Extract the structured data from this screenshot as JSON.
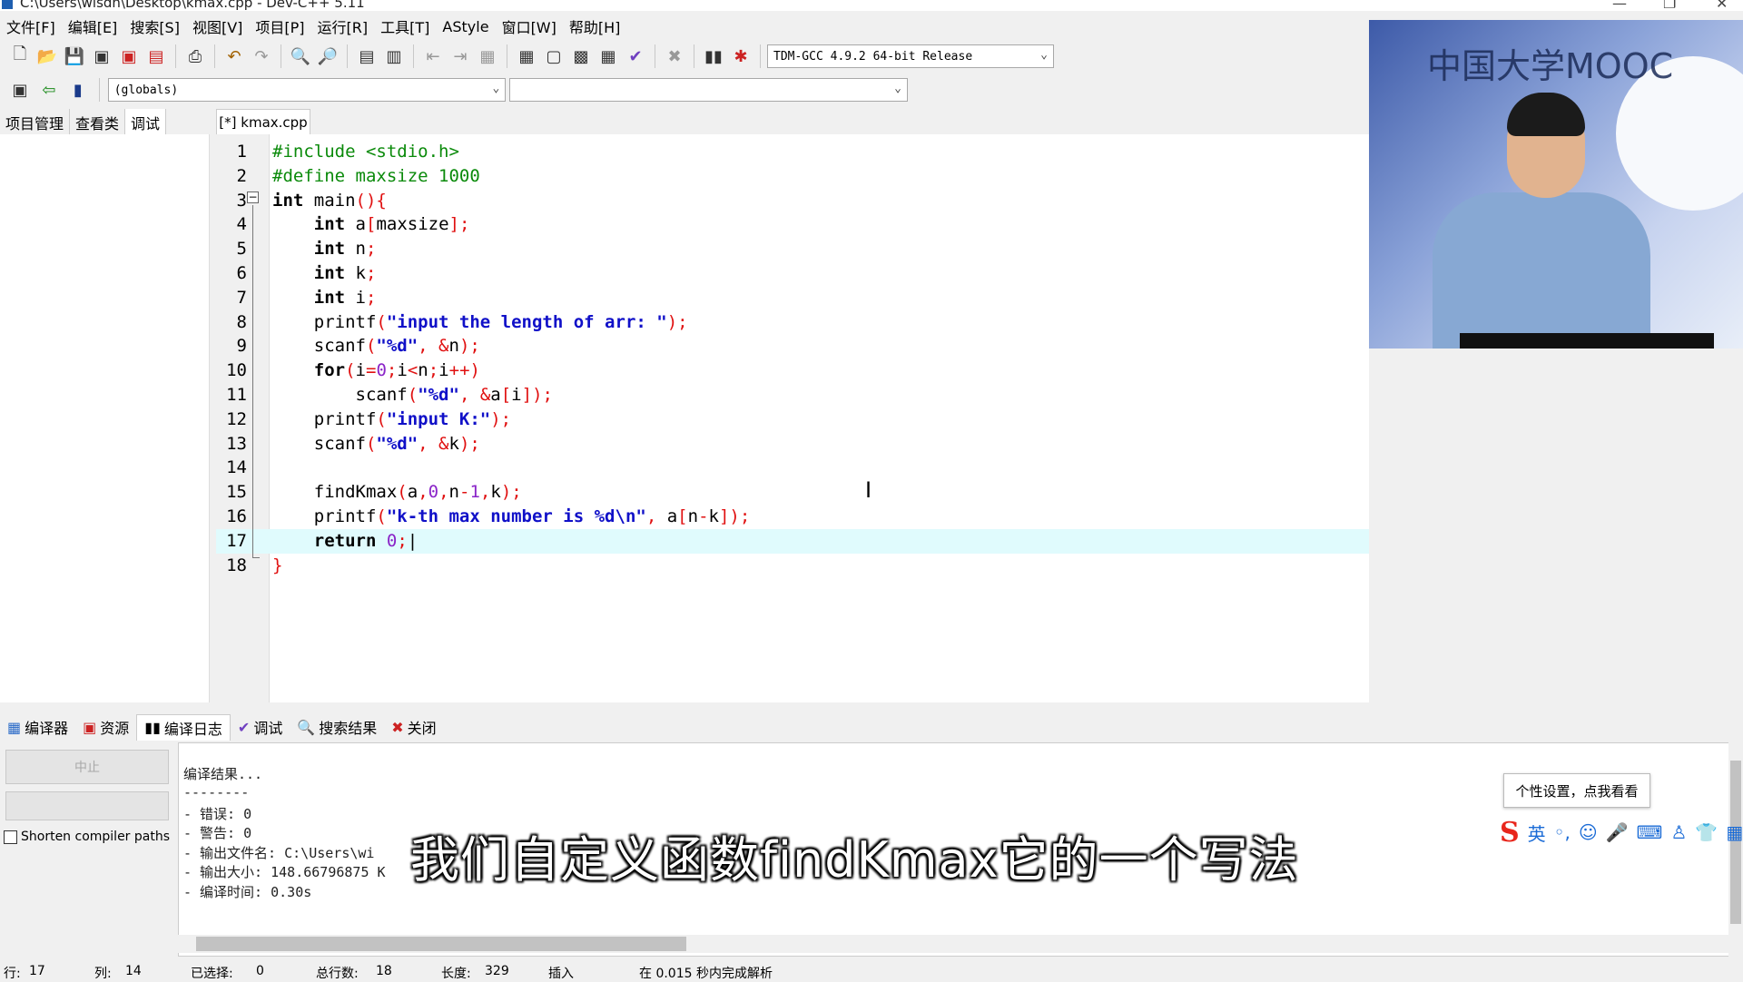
{
  "window": {
    "title": "C:\\Users\\wisdn\\Desktop\\kmax.cpp - Dev-C++ 5.11"
  },
  "menu": [
    "文件[F]",
    "编辑[E]",
    "搜索[S]",
    "视图[V]",
    "项目[P]",
    "运行[R]",
    "工具[T]",
    "AStyle",
    "窗口[W]",
    "帮助[H]"
  ],
  "toolbar": {
    "compiler": "TDM-GCC 4.9.2 64-bit Release",
    "scope": "(globals)",
    "symbol": ""
  },
  "left_tabs": [
    "项目管理",
    "查看类",
    "调试"
  ],
  "editor": {
    "tab": "[*] kmax.cpp",
    "lines": [
      {
        "n": "1",
        "tokens": [
          {
            "c": "pp",
            "t": "#include <stdio.h>"
          }
        ]
      },
      {
        "n": "2",
        "tokens": [
          {
            "c": "pp",
            "t": "#define maxsize 1000"
          }
        ]
      },
      {
        "n": "3",
        "tokens": [
          {
            "c": "kw",
            "t": "int"
          },
          {
            "c": "id",
            "t": " main"
          },
          {
            "c": "sym",
            "t": "(){"
          }
        ]
      },
      {
        "n": "4",
        "tokens": [
          {
            "c": "id",
            "t": "    "
          },
          {
            "c": "kw",
            "t": "int"
          },
          {
            "c": "id",
            "t": " a"
          },
          {
            "c": "sym",
            "t": "["
          },
          {
            "c": "id",
            "t": "maxsize"
          },
          {
            "c": "sym",
            "t": "];"
          }
        ]
      },
      {
        "n": "5",
        "tokens": [
          {
            "c": "id",
            "t": "    "
          },
          {
            "c": "kw",
            "t": "int"
          },
          {
            "c": "id",
            "t": " n"
          },
          {
            "c": "sym",
            "t": ";"
          }
        ]
      },
      {
        "n": "6",
        "tokens": [
          {
            "c": "id",
            "t": "    "
          },
          {
            "c": "kw",
            "t": "int"
          },
          {
            "c": "id",
            "t": " k"
          },
          {
            "c": "sym",
            "t": ";"
          }
        ]
      },
      {
        "n": "7",
        "tokens": [
          {
            "c": "id",
            "t": "    "
          },
          {
            "c": "kw",
            "t": "int"
          },
          {
            "c": "id",
            "t": " i"
          },
          {
            "c": "sym",
            "t": ";"
          }
        ]
      },
      {
        "n": "8",
        "tokens": [
          {
            "c": "id",
            "t": "    printf"
          },
          {
            "c": "sym",
            "t": "("
          },
          {
            "c": "str",
            "t": "\"input the length of arr: \""
          },
          {
            "c": "sym",
            "t": ");"
          }
        ]
      },
      {
        "n": "9",
        "tokens": [
          {
            "c": "id",
            "t": "    scanf"
          },
          {
            "c": "sym",
            "t": "("
          },
          {
            "c": "str",
            "t": "\"%d\""
          },
          {
            "c": "sym",
            "t": ", &"
          },
          {
            "c": "id",
            "t": "n"
          },
          {
            "c": "sym",
            "t": ");"
          }
        ]
      },
      {
        "n": "10",
        "tokens": [
          {
            "c": "id",
            "t": "    "
          },
          {
            "c": "kw",
            "t": "for"
          },
          {
            "c": "sym",
            "t": "("
          },
          {
            "c": "id",
            "t": "i"
          },
          {
            "c": "sym",
            "t": "="
          },
          {
            "c": "numv",
            "t": "0"
          },
          {
            "c": "sym",
            "t": ";"
          },
          {
            "c": "id",
            "t": "i"
          },
          {
            "c": "sym",
            "t": "<"
          },
          {
            "c": "id",
            "t": "n"
          },
          {
            "c": "sym",
            "t": ";"
          },
          {
            "c": "id",
            "t": "i"
          },
          {
            "c": "sym",
            "t": "++)"
          }
        ]
      },
      {
        "n": "11",
        "tokens": [
          {
            "c": "id",
            "t": "        scanf"
          },
          {
            "c": "sym",
            "t": "("
          },
          {
            "c": "str",
            "t": "\"%d\""
          },
          {
            "c": "sym",
            "t": ", &"
          },
          {
            "c": "id",
            "t": "a"
          },
          {
            "c": "sym",
            "t": "["
          },
          {
            "c": "id",
            "t": "i"
          },
          {
            "c": "sym",
            "t": "]);"
          }
        ]
      },
      {
        "n": "12",
        "tokens": [
          {
            "c": "id",
            "t": "    printf"
          },
          {
            "c": "sym",
            "t": "("
          },
          {
            "c": "str",
            "t": "\"input K:\""
          },
          {
            "c": "sym",
            "t": ");"
          }
        ]
      },
      {
        "n": "13",
        "tokens": [
          {
            "c": "id",
            "t": "    scanf"
          },
          {
            "c": "sym",
            "t": "("
          },
          {
            "c": "str",
            "t": "\"%d\""
          },
          {
            "c": "sym",
            "t": ", &"
          },
          {
            "c": "id",
            "t": "k"
          },
          {
            "c": "sym",
            "t": ");"
          }
        ]
      },
      {
        "n": "14",
        "tokens": []
      },
      {
        "n": "15",
        "tokens": [
          {
            "c": "id",
            "t": "    findKmax"
          },
          {
            "c": "sym",
            "t": "("
          },
          {
            "c": "id",
            "t": "a"
          },
          {
            "c": "sym",
            "t": ","
          },
          {
            "c": "numv",
            "t": "0"
          },
          {
            "c": "sym",
            "t": ","
          },
          {
            "c": "id",
            "t": "n"
          },
          {
            "c": "sym",
            "t": "-"
          },
          {
            "c": "numv",
            "t": "1"
          },
          {
            "c": "sym",
            "t": ","
          },
          {
            "c": "id",
            "t": "k"
          },
          {
            "c": "sym",
            "t": ");"
          }
        ]
      },
      {
        "n": "16",
        "tokens": [
          {
            "c": "id",
            "t": "    printf"
          },
          {
            "c": "sym",
            "t": "("
          },
          {
            "c": "str",
            "t": "\"k-th max number is %d\\n\""
          },
          {
            "c": "sym",
            "t": ", "
          },
          {
            "c": "id",
            "t": "a"
          },
          {
            "c": "sym",
            "t": "["
          },
          {
            "c": "id",
            "t": "n"
          },
          {
            "c": "sym",
            "t": "-"
          },
          {
            "c": "id",
            "t": "k"
          },
          {
            "c": "sym",
            "t": "]);"
          }
        ]
      },
      {
        "n": "17",
        "tokens": [
          {
            "c": "id",
            "t": "    "
          },
          {
            "c": "kw",
            "t": "return"
          },
          {
            "c": "id",
            "t": " "
          },
          {
            "c": "numv",
            "t": "0"
          },
          {
            "c": "sym",
            "t": ";"
          },
          {
            "c": "id",
            "t": "|"
          }
        ]
      },
      {
        "n": "18",
        "tokens": [
          {
            "c": "sym",
            "t": "}"
          }
        ]
      }
    ]
  },
  "bottom_tabs": [
    "编译器",
    "资源",
    "编译日志",
    "调试",
    "搜索结果",
    "关闭"
  ],
  "bottom_tab_icons": [
    "grid-icon",
    "resources-icon",
    "chart-icon",
    "check-icon",
    "search-icon",
    "close-icon"
  ],
  "abort_button": "中止",
  "shorten_paths": {
    "label": "Shorten compiler paths",
    "checked": false
  },
  "log": [
    "编译结果...",
    "--------",
    "- 错误: 0",
    "- 警告: 0",
    "- 输出文件名: C:\\Users\\wi",
    "- 输出大小: 148.66796875 K",
    "- 编译时间: 0.30s"
  ],
  "status": {
    "row_label": "行:",
    "row": "17",
    "col_label": "列:",
    "col": "14",
    "sel_label": "已选择:",
    "sel": "0",
    "lines_label": "总行数:",
    "lines": "18",
    "len_label": "长度:",
    "len": "329",
    "mode": "插入",
    "parse": "在 0.015 秒内完成解析"
  },
  "subtitle": "我们自定义函数findKmax它的一个写法",
  "video": {
    "logo": "中国大学MOOC"
  },
  "ime": {
    "tip": "个性设置，点我看看",
    "lang": "英"
  },
  "colors": {
    "current_line": "#e0fbfd",
    "preprocessor": "#0a8a0a",
    "string": "#1010c8",
    "symbol": "#e01010",
    "number": "#8a24c8"
  }
}
